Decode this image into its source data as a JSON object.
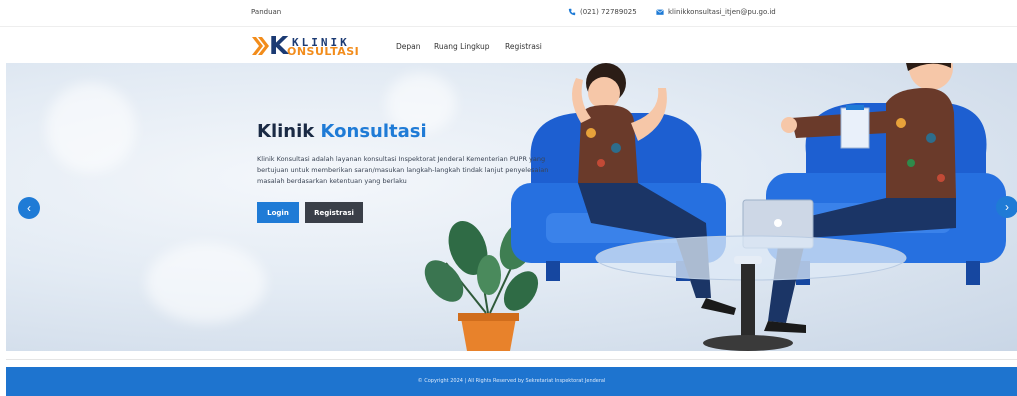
{
  "topbar": {
    "guide_label": "Panduan",
    "phone": "(021) 72789025",
    "email": "klinikkonsultasi_itjen@pu.go.id"
  },
  "brand": {
    "logo_top": "KLINIK",
    "logo_bottom": "ONSULTASI",
    "logo_letter": "K"
  },
  "nav": {
    "items": [
      "Depan",
      "Ruang Lingkup",
      "Registrasi"
    ]
  },
  "hero": {
    "title_part1": "Klinik",
    "title_part2": "Konsultasi",
    "description": "Klinik Konsultasi adalah layanan konsultasi Inspektorat Jenderal Kementerian PUPR yang bertujuan untuk memberikan saran/masukan langkah-langkah tindak lanjut penyelesaian masalah berdasarkan ketentuan yang berlaku",
    "login_label": "Login",
    "register_label": "Registrasi",
    "prev_icon": "‹",
    "next_icon": "›"
  },
  "footer": {
    "copyright": "© Copyright 2024 | All Rights Reserved by Sekretariat Inspektorat Jenderal"
  },
  "colors": {
    "accent": "#1f7bd6",
    "dark": "#1a2a44",
    "logo_orange": "#f28c1b",
    "footer": "#1e74cf",
    "dark_button": "#3a3f48"
  }
}
